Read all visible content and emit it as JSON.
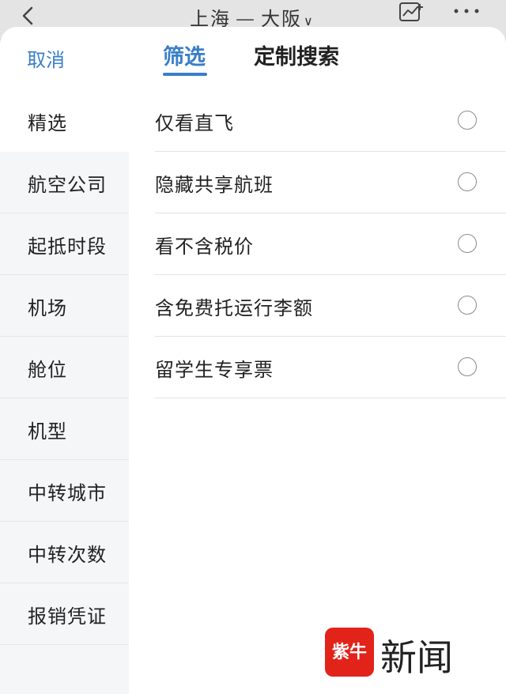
{
  "header": {
    "route_from": "上海",
    "route_separator": "—",
    "route_to": "大阪",
    "route_chevron": "∨",
    "icons": [
      "back-icon",
      "trend-chart-icon",
      "more-icon"
    ]
  },
  "sheet": {
    "cancel_label": "取消",
    "tabs": [
      {
        "label": "筛选",
        "active": true
      },
      {
        "label": "定制搜索",
        "active": false
      }
    ],
    "accent_color": "#3a7fc7"
  },
  "categories": [
    {
      "label": "精选",
      "active": true
    },
    {
      "label": "航空公司",
      "active": false
    },
    {
      "label": "起抵时段",
      "active": false
    },
    {
      "label": "机场",
      "active": false
    },
    {
      "label": "舱位",
      "active": false
    },
    {
      "label": "机型",
      "active": false
    },
    {
      "label": "中转城市",
      "active": false
    },
    {
      "label": "中转次数",
      "active": false
    },
    {
      "label": "报销凭证",
      "active": false
    }
  ],
  "options": [
    {
      "label": "仅看直飞",
      "checked": false
    },
    {
      "label": "隐藏共享航班",
      "checked": false
    },
    {
      "label": "看不含税价",
      "checked": false
    },
    {
      "label": "含免费托运行李额",
      "checked": false
    },
    {
      "label": "留学生专享票",
      "checked": false
    }
  ],
  "watermark": {
    "badge_text": "紫牛",
    "text": "新闻"
  }
}
